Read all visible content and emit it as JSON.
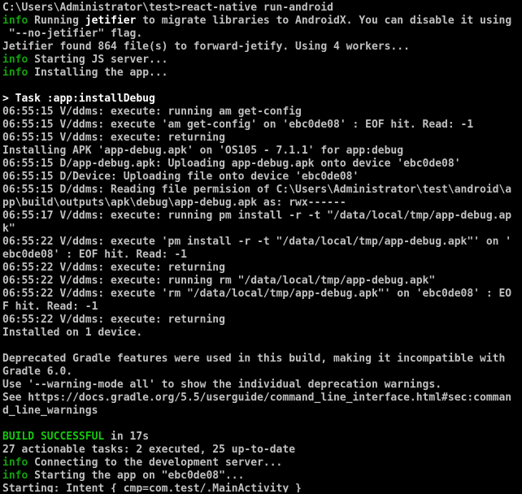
{
  "colors": {
    "background": "#000000",
    "text": "#c0c0c0",
    "info_tag": "#13a10e",
    "success_tag": "#16c60c",
    "highlight": "#ffffff"
  },
  "lines": [
    {
      "text": "C:\\Users\\Administrator\\test>react-native run-android"
    },
    {
      "tag": "info",
      "parts": [
        {
          "text": " Running "
        },
        {
          "text": "jetifier",
          "hl": true
        },
        {
          "text": " to migrate libraries to AndroidX. You can disable it using"
        }
      ]
    },
    {
      "text": " \"--no-jetifier\" flag."
    },
    {
      "text": "Jetifier found 864 file(s) to forward-jetify. Using 4 workers..."
    },
    {
      "tag": "info",
      "text": " Starting JS server..."
    },
    {
      "tag": "info",
      "text": " Installing the app..."
    },
    {
      "text": ""
    },
    {
      "parts": [
        {
          "text": "> Task :app:installDebug",
          "hl": true
        }
      ]
    },
    {
      "text": "06:55:15 V/ddms: execute: running am get-config"
    },
    {
      "text": "06:55:15 V/ddms: execute 'am get-config' on 'ebc0de08' : EOF hit. Read: -1"
    },
    {
      "text": "06:55:15 V/ddms: execute: returning"
    },
    {
      "text": "Installing APK 'app-debug.apk' on 'OS105 - 7.1.1' for app:debug"
    },
    {
      "text": "06:55:15 D/app-debug.apk: Uploading app-debug.apk onto device 'ebc0de08'"
    },
    {
      "text": "06:55:15 D/Device: Uploading file onto device 'ebc0de08'"
    },
    {
      "text": "06:55:15 D/ddms: Reading file permision of C:\\Users\\Administrator\\test\\android\\a"
    },
    {
      "text": "pp\\build\\outputs\\apk\\debug\\app-debug.apk as: rwx------"
    },
    {
      "text": "06:55:17 V/ddms: execute: running pm install -r -t \"/data/local/tmp/app-debug.ap"
    },
    {
      "text": "k\""
    },
    {
      "text": "06:55:22 V/ddms: execute 'pm install -r -t \"/data/local/tmp/app-debug.apk\"' on '"
    },
    {
      "text": "ebc0de08' : EOF hit. Read: -1"
    },
    {
      "text": "06:55:22 V/ddms: execute: returning"
    },
    {
      "text": "06:55:22 V/ddms: execute: running rm \"/data/local/tmp/app-debug.apk\""
    },
    {
      "text": "06:55:22 V/ddms: execute 'rm \"/data/local/tmp/app-debug.apk\"' on 'ebc0de08' : EO"
    },
    {
      "text": "F hit. Read: -1"
    },
    {
      "text": "06:55:22 V/ddms: execute: returning"
    },
    {
      "text": "Installed on 1 device."
    },
    {
      "text": ""
    },
    {
      "text": "Deprecated Gradle features were used in this build, making it incompatible with"
    },
    {
      "text": "Gradle 6.0."
    },
    {
      "text": "Use '--warning-mode all' to show the individual deprecation warnings."
    },
    {
      "text": "See https://docs.gradle.org/5.5/userguide/command_line_interface.html#sec:comman"
    },
    {
      "text": "d_line_warnings"
    },
    {
      "text": ""
    },
    {
      "tag": "success",
      "text": " in 17s"
    },
    {
      "text": "27 actionable tasks: 2 executed, 25 up-to-date"
    },
    {
      "tag": "info",
      "text": " Connecting to the development server..."
    },
    {
      "tag": "info",
      "text": " Starting the app on \"ebc0de08\"..."
    },
    {
      "text": "Starting: Intent { cmp=com.test/.MainActivity }"
    }
  ],
  "tags": {
    "info": "info",
    "success": "BUILD SUCCESSFUL"
  }
}
